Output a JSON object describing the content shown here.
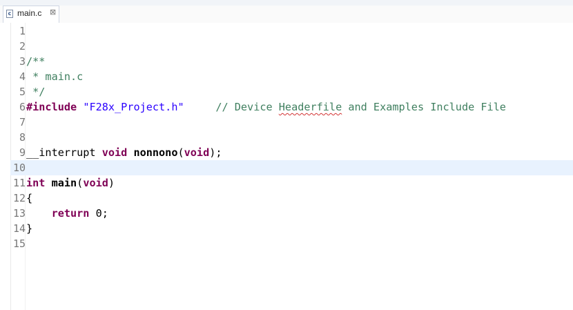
{
  "tab": {
    "filename": "main.c",
    "icon": "c-source-file-icon",
    "close_glyph": "⊠"
  },
  "lines": [
    {
      "num": "1"
    },
    {
      "num": "2"
    },
    {
      "num": "3",
      "comment": "/**"
    },
    {
      "num": "4",
      "comment": " * main.c"
    },
    {
      "num": "5",
      "comment": " */"
    },
    {
      "num": "6",
      "directive": "#include",
      "space1": " ",
      "string": "\"F28x_Project.h\"",
      "space2": "     ",
      "comment_a": "// Device ",
      "comment_b": "Headerfile",
      "comment_c": " and Examples Include File"
    },
    {
      "num": "7"
    },
    {
      "num": "8"
    },
    {
      "num": "9",
      "plain1": "__interrupt ",
      "kw": "void",
      "space": " ",
      "fn": "nonnono",
      "open": "(",
      "kw2": "void",
      "close": ");"
    },
    {
      "num": "10"
    },
    {
      "num": "11",
      "kw": "int",
      "space": " ",
      "fn": "main",
      "open": "(",
      "kw2": "void",
      "close": ")"
    },
    {
      "num": "12",
      "text": "{"
    },
    {
      "num": "13",
      "indent": "    ",
      "kw": "return",
      "rest": " 0;"
    },
    {
      "num": "14",
      "text": "}"
    },
    {
      "num": "15"
    }
  ],
  "colors": {
    "comment": "#3f7f5f",
    "keyword": "#7f0055",
    "string": "#2a00ff",
    "current_line": "#e8f2fe"
  }
}
